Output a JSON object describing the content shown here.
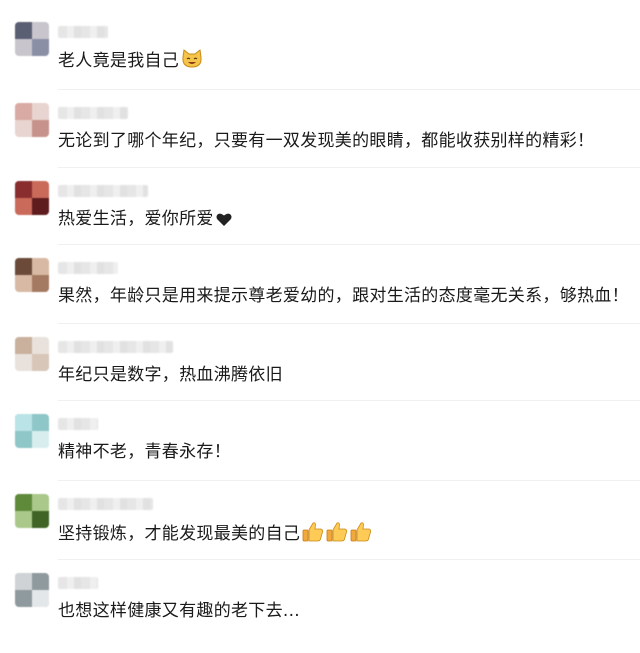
{
  "comments": [
    {
      "text": "老人竟是我自己",
      "emoji": [
        "cat-face"
      ]
    },
    {
      "text": "无论到了哪个年纪，只要有一双发现美的眼睛，都能收获别样的精彩！",
      "emoji": []
    },
    {
      "text": "热爱生活，爱你所爱",
      "emoji": [
        "black-heart"
      ]
    },
    {
      "text": "果然，年龄只是用来提示尊老爱幼的，跟对生活的态度毫无关系，够热血！",
      "emoji": []
    },
    {
      "text": "年纪只是数字，热血沸腾依旧",
      "emoji": []
    },
    {
      "text": "精神不老，青春永存！",
      "emoji": []
    },
    {
      "text": "坚持锻炼，才能发现最美的自己",
      "emoji": [
        "thumbs-up",
        "thumbs-up",
        "thumbs-up"
      ]
    },
    {
      "text": "也想这样健康又有趣的老下去...",
      "emoji": []
    }
  ],
  "avatar_colors": [
    [
      "#5a5f73",
      "#c8c6cc",
      "#8a8fa6"
    ],
    [
      "#d9a9a3",
      "#e8d4d0",
      "#c7928b"
    ],
    [
      "#8a2d2f",
      "#c96a5a",
      "#5e1c1f"
    ],
    [
      "#6b4a3a",
      "#d8b9a4",
      "#a57a63"
    ],
    [
      "#c9b19d",
      "#e9e2dc",
      "#d8c6b8"
    ],
    [
      "#b9e3e6",
      "#8fc7c9",
      "#d8eeee"
    ],
    [
      "#5e8a3a",
      "#aac88a",
      "#3f6426"
    ],
    [
      "#cfd3d6",
      "#8f9a9e",
      "#e4e7e9"
    ]
  ]
}
